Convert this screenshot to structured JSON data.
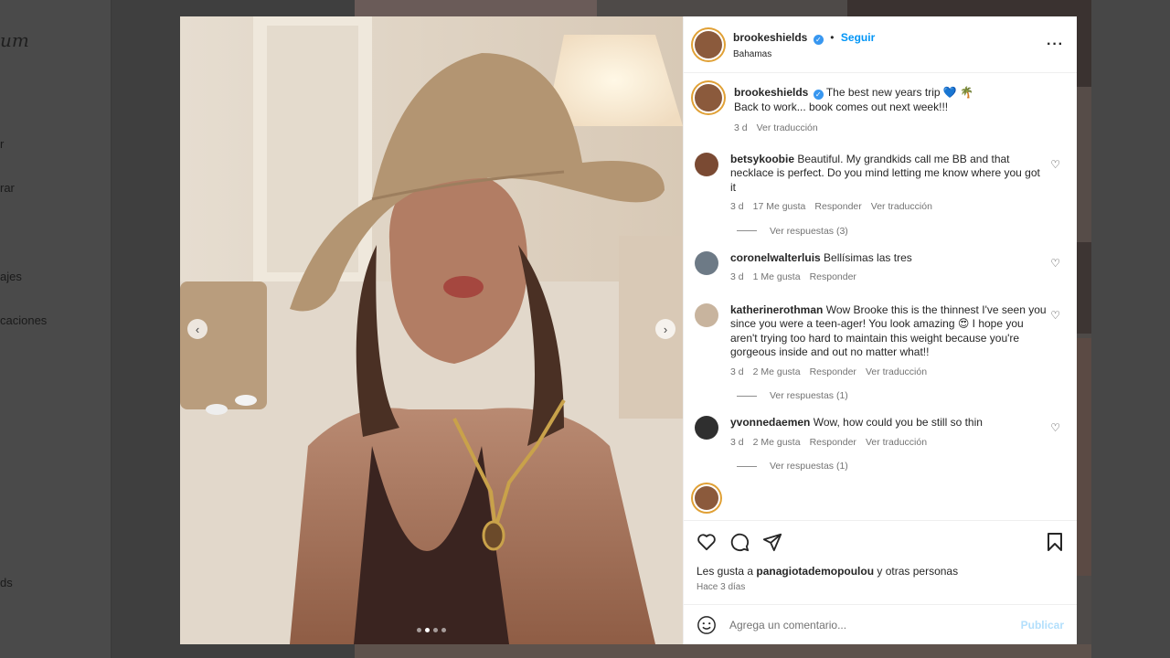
{
  "background": {
    "logo": "um",
    "nav": [
      "r",
      "rar",
      "ajes",
      "caciones",
      "ds"
    ]
  },
  "post": {
    "author": "brookeshields",
    "follow_label": "Seguir",
    "location": "Bahamas",
    "caption_line1": "The best new years trip 💙 🌴",
    "caption_line2": "Back to work... book comes out next week!!!",
    "caption_time": "3 d",
    "caption_translate": "Ver traducción",
    "photo_alt": "",
    "carousel": {
      "count": 4,
      "active": 1
    }
  },
  "comments": [
    {
      "user": "betsykoobie",
      "text": "Beautiful. My grandkids call me BB and that necklace is perfect. Do you mind letting me know where you got it",
      "time": "3 d",
      "likes": "17 Me gusta",
      "reply": "Responder",
      "translate": "Ver traducción",
      "view_replies": "Ver respuestas (3)"
    },
    {
      "user": "coronelwalterluis",
      "text": "Bellísimas las tres",
      "time": "3 d",
      "likes": "1 Me gusta",
      "reply": "Responder"
    },
    {
      "user": "katherinerothman",
      "text": "Wow Brooke this is the thinnest I've seen you since you were a teen-ager! You look amazing 😍 I hope you aren't trying too hard to maintain this weight because you're gorgeous inside and out no matter what!!",
      "time": "3 d",
      "likes": "2 Me gusta",
      "reply": "Responder",
      "translate": "Ver traducción",
      "view_replies": "Ver respuestas (1)"
    },
    {
      "user": "yvonnedaemen",
      "text": "Wow, how could you be still so thin",
      "time": "3 d",
      "likes": "2 Me gusta",
      "reply": "Responder",
      "translate": "Ver traducción",
      "view_replies": "Ver respuestas (1)"
    }
  ],
  "footer": {
    "likes_prefix": "Les gusta a ",
    "likes_user": "panagiotademopoulou",
    "likes_suffix": " y otras personas",
    "posted_ago": "Hace 3 días",
    "comment_placeholder": "Agrega un comentario...",
    "publish_label": "Publicar"
  },
  "colors": {
    "link": "#0095f6",
    "verified": "#3897f0",
    "publish_disabled": "#b2dffc",
    "story_ring": "#e0a035"
  }
}
